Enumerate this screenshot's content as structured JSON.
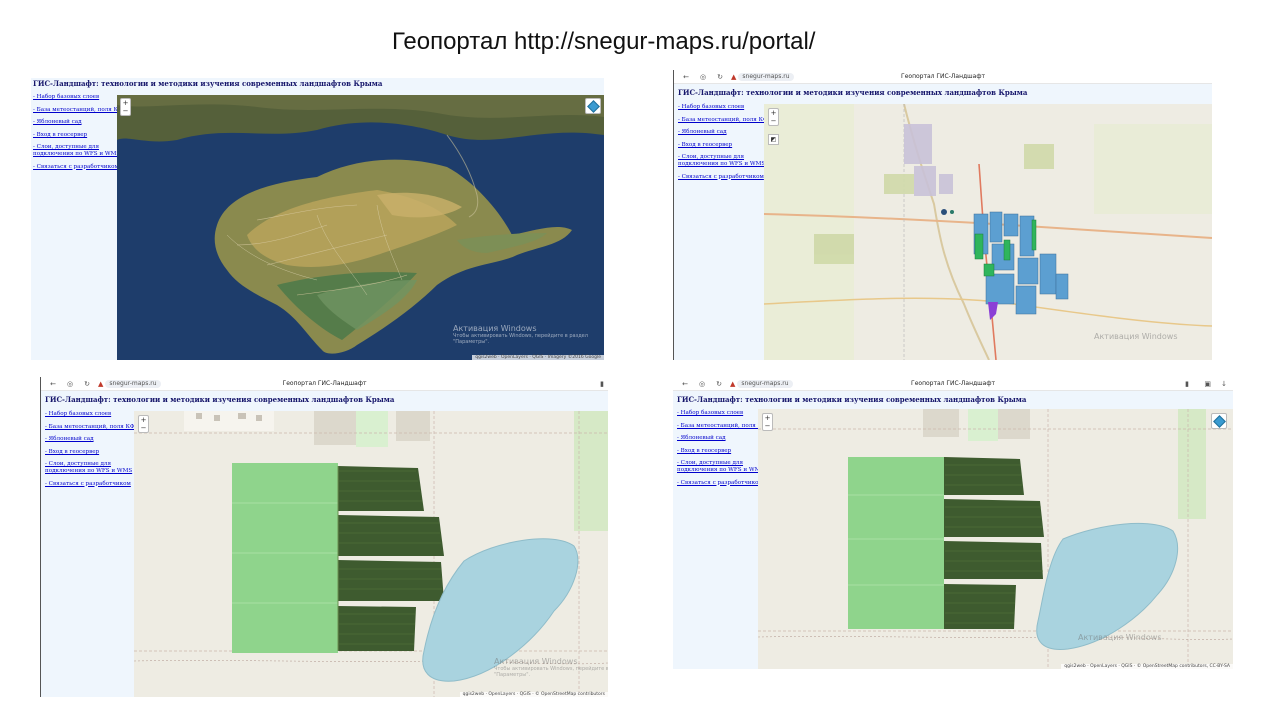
{
  "slide": {
    "title": "Геопортал http://snegur-maps.ru/portal/"
  },
  "app": {
    "title": "ГИС-Ландшафт: технологии и методики изучения современных ландшафтов Крыма",
    "menu": [
      "- Набор базовых слоев",
      "- База метеостанций, поля КФУ",
      "- Яблоневый сад",
      "- Вход в геосервер",
      "- Слои, доступные для",
      "подключения по WFS и WMS",
      "- Связаться с разработчиком"
    ]
  },
  "browser": {
    "url": "snegur-maps.ru",
    "tab_landscape": "Геопортал ГИС-Ландшафт",
    "tab_landshaft_short": "Геопортал ГИС-Ландшафт"
  },
  "map": {
    "zoom_in": "+",
    "zoom_out": "−",
    "attribution_google": "qgis2web · OpenLayers · QGIS · Imagery ©2016 Google",
    "attribution_osm": "qgis2web · OpenLayers · QGIS · © OpenStreetMap contributors",
    "attribution_osm_full": "qgis2web · OpenLayers · QGIS · © OpenStreetMap contributors, CC-BY-SA",
    "watermark_title": "Активация Windows",
    "watermark_sub": "Чтобы активировать Windows, перейдите в раздел",
    "watermark_sub2": "\"Параметры\"."
  },
  "colors": {
    "sidebar_bg": "#eff6fd",
    "title_color": "#16166b",
    "link_color": "#0000cc",
    "field_light": "#8fd48c",
    "orchard_dark": "#3e5b2f",
    "reservoir": "#a9d3df",
    "osm_bg": "#eeece3",
    "sea": "#1e3d6b"
  }
}
